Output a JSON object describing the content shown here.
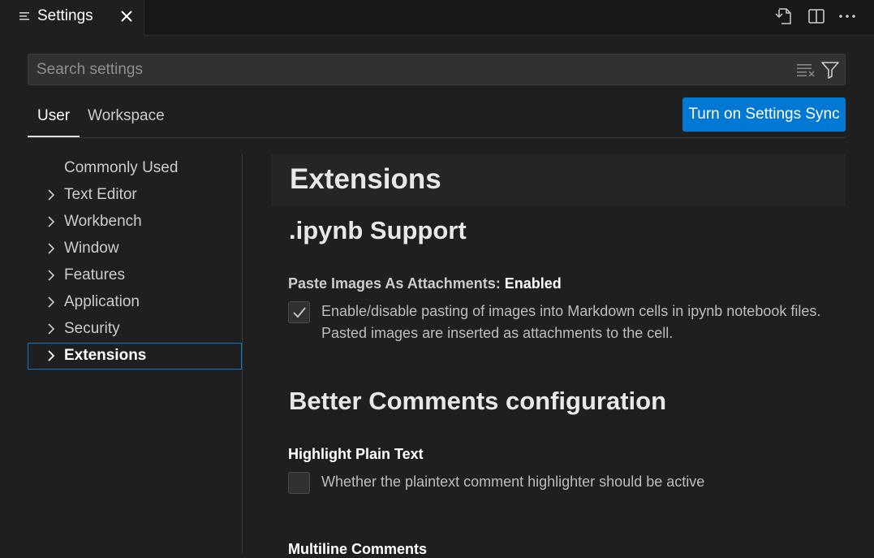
{
  "tab": {
    "label": "Settings",
    "icon": "settings-editor-icon"
  },
  "title_actions": [
    "open-settings-json-icon",
    "split-editor-icon",
    "more-actions-icon"
  ],
  "search": {
    "placeholder": "Search settings",
    "value": ""
  },
  "scope_tabs": {
    "user": "User",
    "workspace": "Workspace",
    "active": "User"
  },
  "sync_button": "Turn on Settings Sync",
  "toc": {
    "items": [
      {
        "label": "Commonly Used",
        "expandable": false
      },
      {
        "label": "Text Editor",
        "expandable": true
      },
      {
        "label": "Workbench",
        "expandable": true
      },
      {
        "label": "Window",
        "expandable": true
      },
      {
        "label": "Features",
        "expandable": true
      },
      {
        "label": "Application",
        "expandable": true
      },
      {
        "label": "Security",
        "expandable": true
      },
      {
        "label": "Extensions",
        "expandable": true,
        "active": true
      }
    ]
  },
  "main": {
    "section_title": "Extensions",
    "groups": [
      {
        "title": ".ipynb Support",
        "settings": [
          {
            "label": "Paste Images As Attachments: ",
            "value": "Enabled",
            "checked": true,
            "description": "Enable/disable pasting of images into Markdown cells in ipynb notebook files. Pasted images are inserted as attachments to the cell."
          }
        ]
      },
      {
        "title": "Better Comments configuration",
        "settings": [
          {
            "label": "Highlight Plain Text",
            "checked": false,
            "description": "Whether the plaintext comment highlighter should be active"
          },
          {
            "label": "Multiline Comments"
          }
        ]
      }
    ]
  },
  "colors": {
    "background": "#1f1f1f",
    "accent": "#0078d4",
    "focus_border": "#0078d4"
  }
}
